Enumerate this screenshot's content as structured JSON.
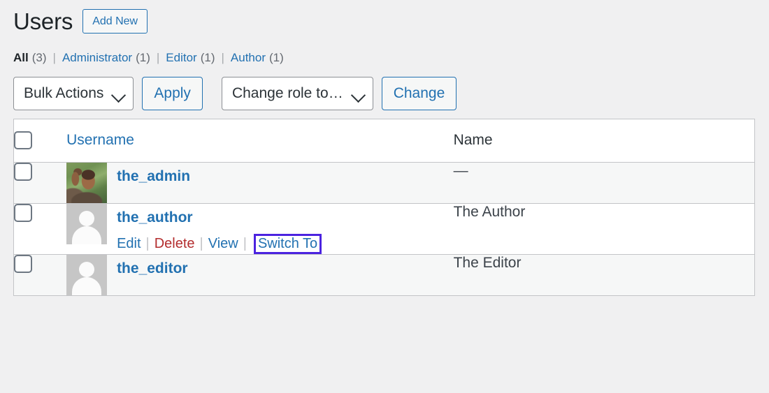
{
  "page": {
    "title": "Users",
    "add_new_label": "Add New"
  },
  "filters": {
    "items": [
      {
        "label": "All",
        "count": "(3)",
        "current": true
      },
      {
        "label": "Administrator",
        "count": "(1)",
        "current": false
      },
      {
        "label": "Editor",
        "count": "(1)",
        "current": false
      },
      {
        "label": "Author",
        "count": "(1)",
        "current": false
      }
    ],
    "separator": "|"
  },
  "tablenav": {
    "bulk_actions_label": "Bulk Actions",
    "apply_label": "Apply",
    "change_role_label": "Change role to…",
    "change_label": "Change"
  },
  "table": {
    "columns": {
      "username": "Username",
      "name": "Name"
    },
    "rows": [
      {
        "username": "the_admin",
        "name": "—",
        "avatar": "photo",
        "actions": []
      },
      {
        "username": "the_author",
        "name": "The Author",
        "avatar": "mystery",
        "actions": [
          {
            "label": "Edit",
            "kind": "edit"
          },
          {
            "label": "Delete",
            "kind": "delete"
          },
          {
            "label": "View",
            "kind": "view"
          },
          {
            "label": "Switch To",
            "kind": "switch-to",
            "highlighted": true
          }
        ]
      },
      {
        "username": "the_editor",
        "name": "The Editor",
        "avatar": "mystery",
        "actions": []
      }
    ]
  },
  "colors": {
    "link": "#2271b1",
    "delete": "#b32d2e",
    "highlight_box": "#4b23e0",
    "page_bg": "#f0f0f1",
    "row_alt_bg": "#f6f7f7",
    "border": "#c3c4c7",
    "heading": "#1d2327"
  }
}
